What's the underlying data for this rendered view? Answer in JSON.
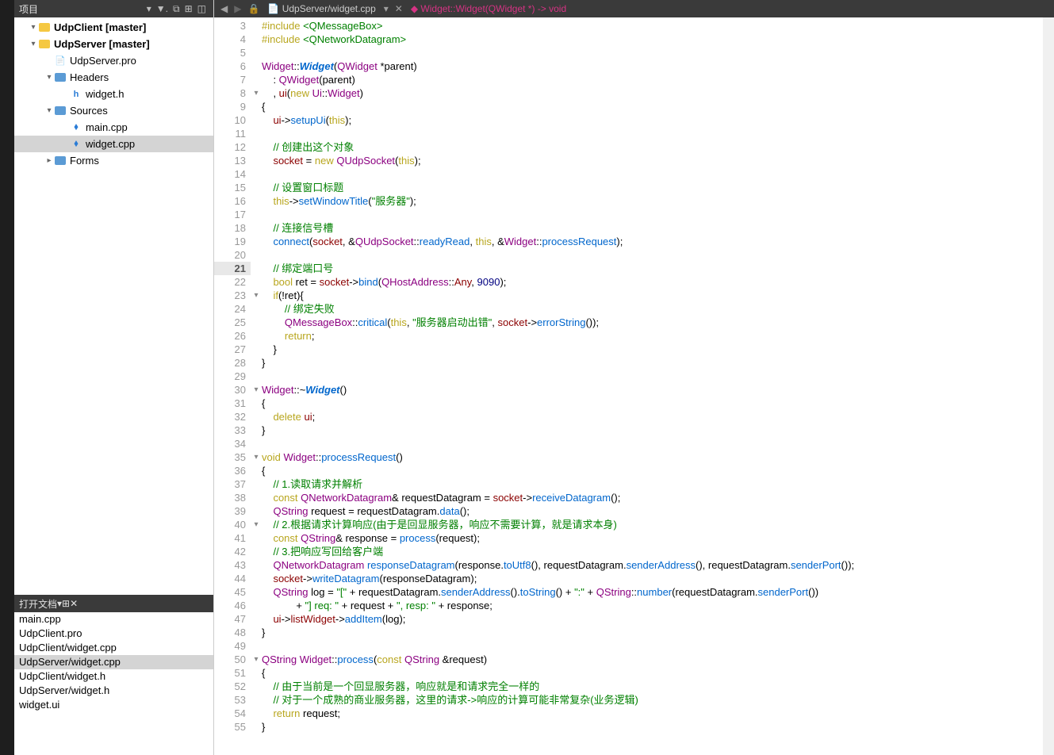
{
  "project_header": "项目",
  "tree": [
    {
      "indent": 0,
      "arrow": "▾",
      "icon": "folder-y",
      "label": "UdpClient [master]",
      "bold": true
    },
    {
      "indent": 0,
      "arrow": "▾",
      "icon": "folder-y",
      "label": "UdpServer [master]",
      "bold": true
    },
    {
      "indent": 1,
      "arrow": "",
      "icon": "file",
      "label": "UdpServer.pro"
    },
    {
      "indent": 1,
      "arrow": "▾",
      "icon": "folder-b",
      "label": "Headers"
    },
    {
      "indent": 2,
      "arrow": "",
      "icon": "file-h",
      "label": "widget.h"
    },
    {
      "indent": 1,
      "arrow": "▾",
      "icon": "folder-b",
      "label": "Sources"
    },
    {
      "indent": 2,
      "arrow": "",
      "icon": "file-cpp",
      "label": "main.cpp"
    },
    {
      "indent": 2,
      "arrow": "",
      "icon": "file-cpp",
      "label": "widget.cpp",
      "selected": true
    },
    {
      "indent": 1,
      "arrow": "▸",
      "icon": "folder-b",
      "label": "Forms"
    }
  ],
  "open_docs_header": "打开文档",
  "open_docs": [
    {
      "label": "main.cpp"
    },
    {
      "label": "UdpClient.pro"
    },
    {
      "label": "UdpClient/widget.cpp"
    },
    {
      "label": "UdpServer/widget.cpp",
      "selected": true
    },
    {
      "label": "UdpClient/widget.h"
    },
    {
      "label": "UdpServer/widget.h"
    },
    {
      "label": "widget.ui"
    }
  ],
  "editor_bar": {
    "file": "UdpServer/widget.cpp",
    "symbol": "Widget::Widget(QWidget *) -> void"
  },
  "first_line": 3,
  "current_line": 21,
  "fold_lines": [
    8,
    23,
    30,
    35,
    40,
    50
  ],
  "code_lines": [
    "<span class='kw'>#include</span> <span class='inc'>&lt;QMessageBox&gt;</span>",
    "<span class='kw'>#include</span> <span class='inc'>&lt;QNetworkDatagram&gt;</span>",
    "",
    "<span class='type'>Widget</span>::<span class='fn italic'>Widget</span>(<span class='type'>QWidget</span> *parent)",
    "    : <span class='type'>QWidget</span>(parent)",
    "    , <span class='mem'>ui</span>(<span class='kw'>new</span> <span class='type'>Ui</span>::<span class='type'>Widget</span>)",
    "{",
    "    <span class='mem'>ui</span>-&gt;<span class='fn'>setupUi</span>(<span class='kw'>this</span>);",
    "",
    "    <span class='cmt'>// 创建出这个对象</span>",
    "    <span class='mem'>socket</span> = <span class='kw'>new</span> <span class='type'>QUdpSocket</span>(<span class='kw'>this</span>);",
    "",
    "    <span class='cmt'>// 设置窗口标题</span>",
    "    <span class='kw'>this</span>-&gt;<span class='fn'>setWindowTitle</span>(<span class='str'>\"服务器\"</span>);",
    "",
    "    <span class='cmt'>// 连接信号槽</span>",
    "    <span class='fn'>connect</span>(<span class='mem'>socket</span>, &amp;<span class='type'>QUdpSocket</span>::<span class='fn'>readyRead</span>, <span class='kw'>this</span>, &amp;<span class='type'>Widget</span>::<span class='fn'>processRequest</span>);",
    "",
    "    <span class='cmt'>// 绑定端口号</span>",
    "    <span class='kw'>bool</span> ret = <span class='mem'>socket</span>-&gt;<span class='fn'>bind</span>(<span class='type'>QHostAddress</span>::<span class='var'>Any</span>, <span class='num'>9090</span>);",
    "    <span class='kw'>if</span>(!ret){",
    "        <span class='cmt'>// 绑定失败</span>",
    "        <span class='type'>QMessageBox</span>::<span class='fn'>critical</span>(<span class='kw'>this</span>, <span class='str'>\"服务器启动出错\"</span>, <span class='mem'>socket</span>-&gt;<span class='fn'>errorString</span>());",
    "        <span class='kw'>return</span>;",
    "    }",
    "}",
    "",
    "<span class='type'>Widget</span>::~<span class='fn italic'>Widget</span>()",
    "{",
    "    <span class='kw'>delete</span> <span class='mem'>ui</span>;",
    "}",
    "",
    "<span class='kw'>void</span> <span class='type'>Widget</span>::<span class='fn'>processRequest</span>()",
    "{",
    "    <span class='cmt'>// 1.读取请求并解析</span>",
    "    <span class='kw'>const</span> <span class='type'>QNetworkDatagram</span>&amp; requestDatagram = <span class='mem'>socket</span>-&gt;<span class='fn'>receiveDatagram</span>();",
    "    <span class='type'>QString</span> request = requestDatagram.<span class='fn'>data</span>();",
    "    <span class='cmt'>// 2.根据请求计算响应(由于是回显服务器，响应不需要计算，就是请求本身)</span>",
    "    <span class='kw'>const</span> <span class='type'>QString</span>&amp; response = <span class='fn'>process</span>(request);",
    "    <span class='cmt'>// 3.把响应写回给客户端</span>",
    "    <span class='type'>QNetworkDatagram</span> <span class='fn'>responseDatagram</span>(response.<span class='fn'>toUtf8</span>(), requestDatagram.<span class='fn'>senderAddress</span>(), requestDatagram.<span class='fn'>senderPort</span>());",
    "    <span class='mem'>socket</span>-&gt;<span class='fn'>writeDatagram</span>(responseDatagram);",
    "    <span class='type'>QString</span> log = <span class='str'>\"[\"</span> + requestDatagram.<span class='fn'>senderAddress</span>().<span class='fn'>toString</span>() + <span class='str'>\":\"</span> + <span class='type'>QString</span>::<span class='fn'>number</span>(requestDatagram.<span class='fn'>senderPort</span>())",
    "            + <span class='str'>\"] req: \"</span> + request + <span class='str'>\", resp: \"</span> + response;",
    "    <span class='mem'>ui</span>-&gt;<span class='mem'>listWidget</span>-&gt;<span class='fn'>addItem</span>(log);",
    "}",
    "",
    "<span class='type'>QString</span> <span class='type'>Widget</span>::<span class='fn'>process</span>(<span class='kw'>const</span> <span class='type'>QString</span> &amp;request)",
    "{",
    "    <span class='cmt'>// 由于当前是一个回显服务器，响应就是和请求完全一样的</span>",
    "    <span class='cmt'>// 对于一个成熟的商业服务器，这里的请求-&gt;响应的计算可能非常复杂(业务逻辑)</span>",
    "    <span class='kw'>return</span> request;",
    "}"
  ]
}
